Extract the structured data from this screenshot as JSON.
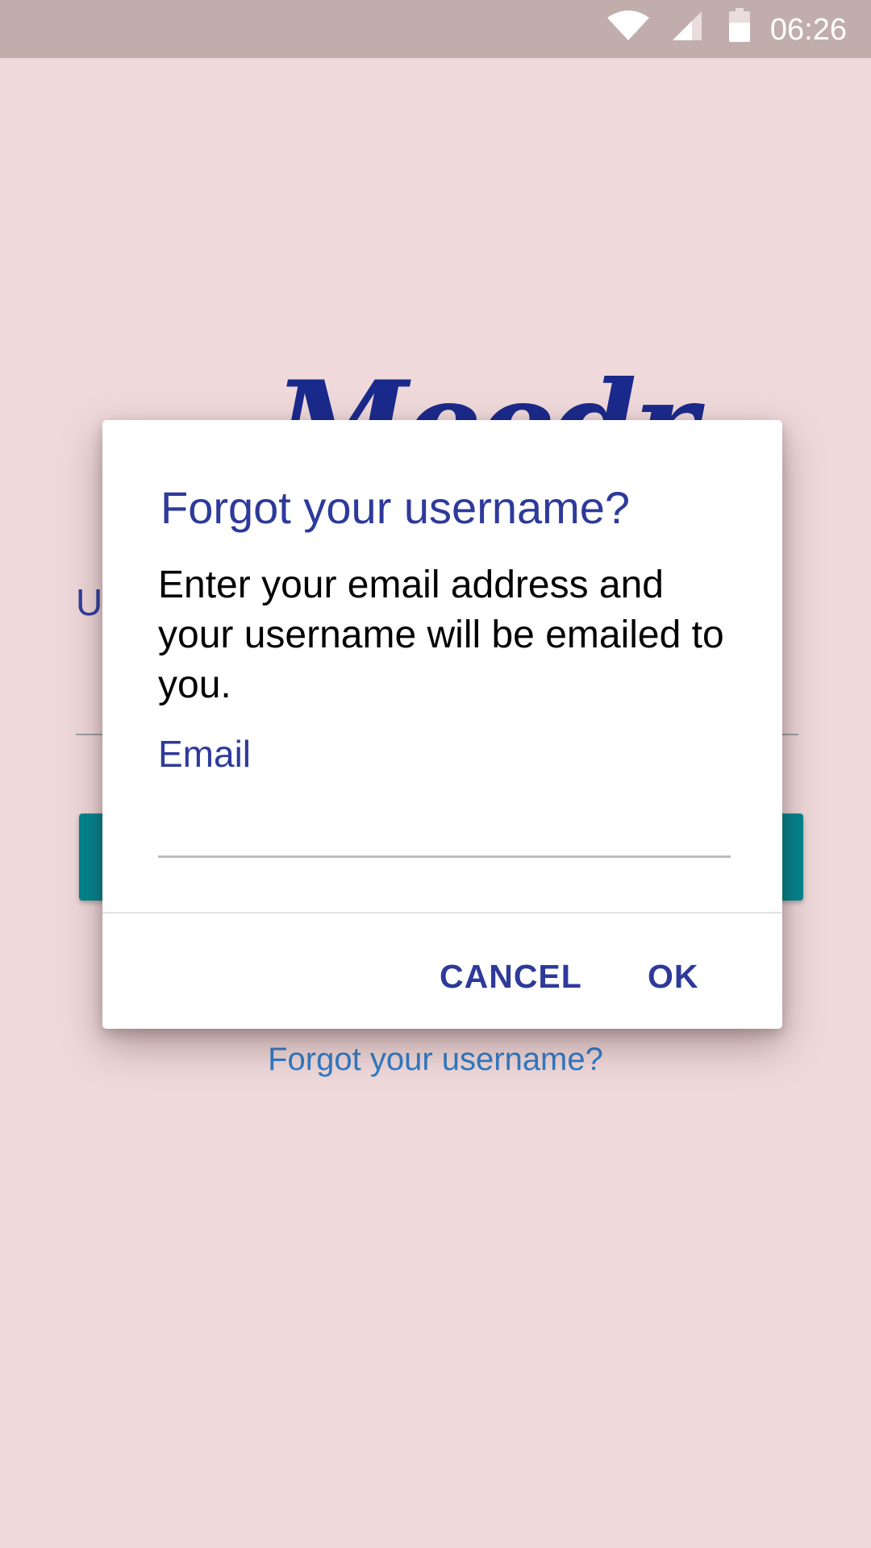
{
  "status_bar": {
    "time": "06:26",
    "icons": [
      "wifi-icon",
      "cell-signal-icon",
      "battery-icon"
    ]
  },
  "background": {
    "logo": "Meedr",
    "field_label": "U",
    "forgot_link": "Forgot your username?"
  },
  "dialog": {
    "title": "Forgot your username?",
    "message": "Enter your email address and your username will be emailed to you.",
    "email_label": "Email",
    "email_value": "",
    "cancel_label": "CANCEL",
    "ok_label": "OK"
  },
  "colors": {
    "background": "#efd9da",
    "status_bar": "#c1adac",
    "accent": "#2e3a9a",
    "button_teal": "#00868f",
    "link": "#2f7cc8"
  }
}
